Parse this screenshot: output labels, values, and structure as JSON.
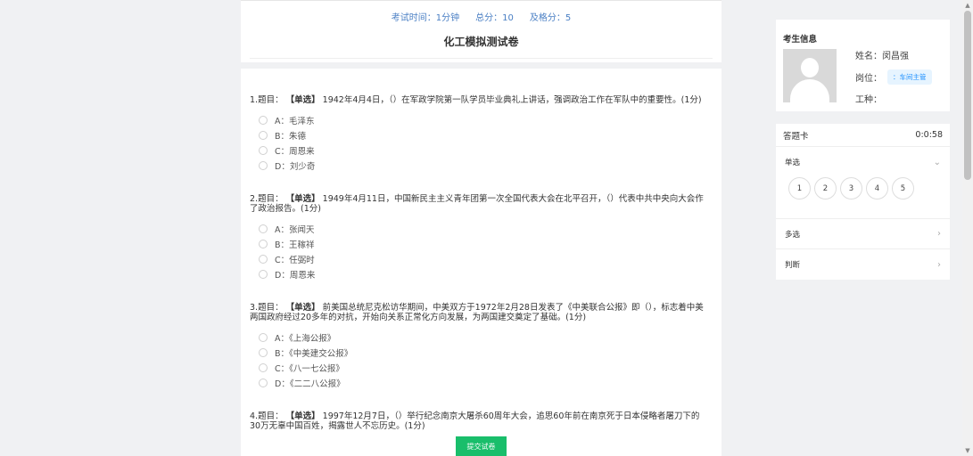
{
  "exam": {
    "time_label": "考试时间：1分钟",
    "total_label": "总分：10",
    "pass_label": "及格分：5",
    "title": "化工模拟测试卷"
  },
  "questions": [
    {
      "prefix": "1.题目：",
      "type": "【单选】",
      "text": "1942年4月4日，（）在军政学院第一队学员毕业典礼上讲话，强调政治工作在军队中的重要性。(1分)",
      "options": [
        "A：毛泽东",
        "B：朱德",
        "C：周恩来",
        "D：刘少奇"
      ]
    },
    {
      "prefix": "2.题目：",
      "type": "【单选】",
      "text": "1949年4月11日，中国新民主主义青年团第一次全国代表大会在北平召开，（）代表中共中央向大会作了政治报告。(1分)",
      "options": [
        "A：张闻天",
        "B：王稼祥",
        "C：任弼时",
        "D：周恩来"
      ]
    },
    {
      "prefix": "3.题目：",
      "type": "【单选】",
      "text": "前美国总统尼克松访华期间，中美双方于1972年2月28日发表了《中美联合公报》即（），标志着中美两国政府经过20多年的对抗，开始向关系正常化方向发展，为两国建交奠定了基础。(1分)",
      "options": [
        "A：《上海公报》",
        "B：《中美建交公报》",
        "C：《八一七公报》",
        "D：《二二八公报》"
      ]
    },
    {
      "prefix": "4.题目：",
      "type": "【单选】",
      "text": "1997年12月7日，（）举行纪念南京大屠杀60周年大会，追思60年前在南京死于日本侵略者屠刀下的30万无辜中国百姓，揭露世人不忘历史。(1分)",
      "options": []
    }
  ],
  "submit_label": "提交试卷",
  "candidate": {
    "section_title": "考生信息",
    "name_label": "姓名：闵昌强",
    "post_label": "岗位：",
    "post_tag": "：车间主管",
    "work_label": "工种："
  },
  "answer_card": {
    "title": "答题卡",
    "timer": "0:0:58",
    "sections": {
      "single": "单选",
      "multi": "多选",
      "judge": "判断"
    },
    "numbers": [
      "1",
      "2",
      "3",
      "4",
      "5"
    ]
  }
}
